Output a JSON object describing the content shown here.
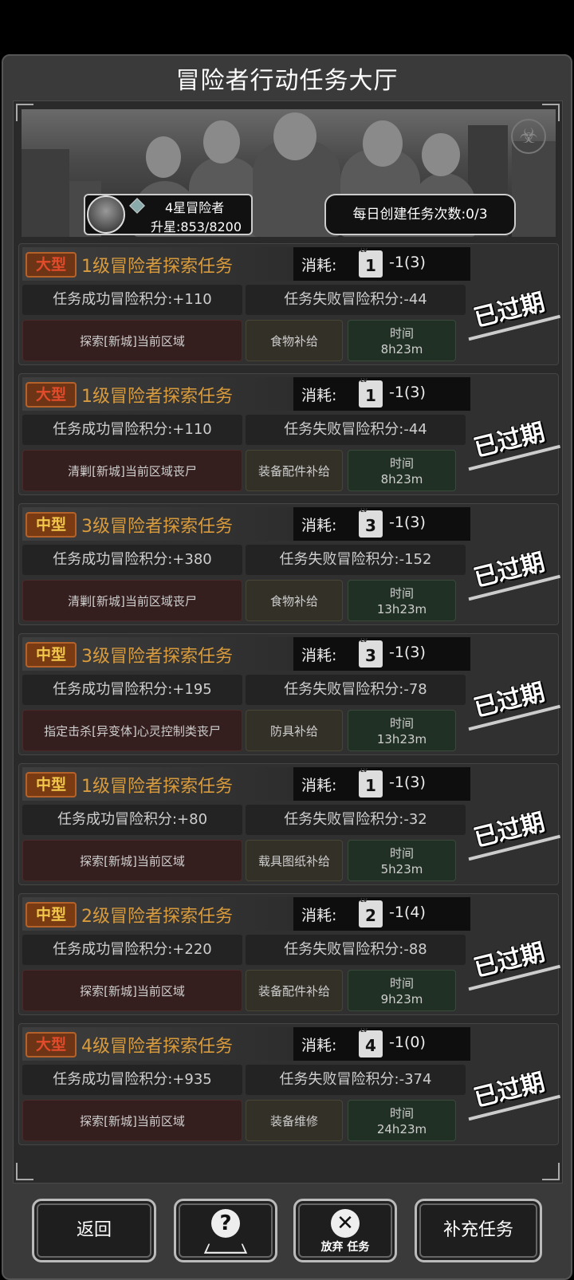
{
  "title": "冒险者行动任务大厅",
  "profile": {
    "rank": "4星冒险者",
    "star_progress": "升星:853/8200"
  },
  "daily": "每日创建任务次数:0/3",
  "tasks": [
    {
      "size": "大型",
      "name": "1级冒险者探索任务",
      "cost_label": "消耗:",
      "ticket": "1",
      "cost": "-1(3)",
      "success": "任务成功冒险积分:+110",
      "fail": "任务失败冒险积分:-44",
      "target": "探索[新城]当前区域",
      "supply": "食物补给",
      "time_label": "时间",
      "time": "8h23m",
      "status": "已过期"
    },
    {
      "size": "大型",
      "name": "1级冒险者探索任务",
      "cost_label": "消耗:",
      "ticket": "1",
      "cost": "-1(3)",
      "success": "任务成功冒险积分:+110",
      "fail": "任务失败冒险积分:-44",
      "target": "清剿[新城]当前区域丧尸",
      "supply": "装备配件补给",
      "time_label": "时间",
      "time": "8h23m",
      "status": "已过期"
    },
    {
      "size": "中型",
      "name": "3级冒险者探索任务",
      "cost_label": "消耗:",
      "ticket": "3",
      "cost": "-1(3)",
      "success": "任务成功冒险积分:+380",
      "fail": "任务失败冒险积分:-152",
      "target": "清剿[新城]当前区域丧尸",
      "supply": "食物补给",
      "time_label": "时间",
      "time": "13h23m",
      "status": "已过期"
    },
    {
      "size": "中型",
      "name": "3级冒险者探索任务",
      "cost_label": "消耗:",
      "ticket": "3",
      "cost": "-1(3)",
      "success": "任务成功冒险积分:+195",
      "fail": "任务失败冒险积分:-78",
      "target": "指定击杀[异变体]心灵控制类丧尸",
      "supply": "防具补给",
      "time_label": "时间",
      "time": "13h23m",
      "status": "已过期"
    },
    {
      "size": "中型",
      "name": "1级冒险者探索任务",
      "cost_label": "消耗:",
      "ticket": "1",
      "cost": "-1(3)",
      "success": "任务成功冒险积分:+80",
      "fail": "任务失败冒险积分:-32",
      "target": "探索[新城]当前区域",
      "supply": "载具图纸补给",
      "time_label": "时间",
      "time": "5h23m",
      "status": "已过期"
    },
    {
      "size": "中型",
      "name": "2级冒险者探索任务",
      "cost_label": "消耗:",
      "ticket": "2",
      "cost": "-1(4)",
      "success": "任务成功冒险积分:+220",
      "fail": "任务失败冒险积分:-88",
      "target": "探索[新城]当前区域",
      "supply": "装备配件补给",
      "time_label": "时间",
      "time": "9h23m",
      "status": "已过期"
    },
    {
      "size": "大型",
      "name": "4级冒险者探索任务",
      "cost_label": "消耗:",
      "ticket": "4",
      "cost": "-1(0)",
      "success": "任务成功冒险积分:+935",
      "fail": "任务失败冒险积分:-374",
      "target": "探索[新城]当前区域",
      "supply": "装备维修",
      "time_label": "时间",
      "time": "24h23m",
      "status": "已过期"
    }
  ],
  "buttons": {
    "back": "返回",
    "abandon": "放弃 任务",
    "refill": "补充任务"
  },
  "icons": {
    "help": "help-icon",
    "abandon": "close-icon",
    "hazard": "biohazard-icon"
  }
}
